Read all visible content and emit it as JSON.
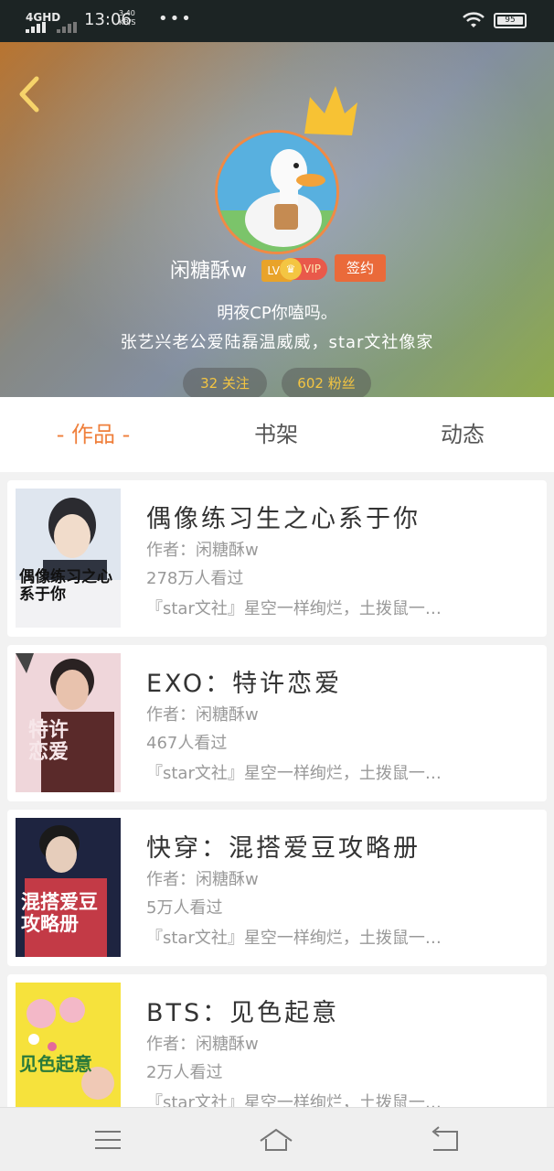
{
  "status_bar": {
    "network": "4GHD",
    "time": "13:06",
    "speed_value": "3.40",
    "speed_unit": "KB/S",
    "dots": "•••",
    "battery": "95"
  },
  "profile": {
    "level": "LV4",
    "username": "闲糖酥w",
    "vip_label": "VIP",
    "contract_label": "签约",
    "bio_line1": "明夜CP你嗑吗。",
    "bio_line2": "张艺兴老公爱陆磊温威威，star文社像家",
    "follow_label": "32 关注",
    "fans_label": "602 粉丝"
  },
  "tabs": [
    {
      "label": "- 作品 -",
      "active": true
    },
    {
      "label": "书架",
      "active": false
    },
    {
      "label": "动态",
      "active": false
    }
  ],
  "books": [
    {
      "title": "偶像练习生之心系于你",
      "author": "作者：闲糖酥w",
      "views": "278万人看过",
      "desc": "『star文社』星空一样绚烂，土拨鼠一…",
      "cover_text": "偶像练习之心系于你"
    },
    {
      "title": "EXO：特许恋爱",
      "author": "作者：闲糖酥w",
      "views": "467人看过",
      "desc": "『star文社』星空一样绚烂，土拨鼠一…",
      "cover_text": "特许恋爱"
    },
    {
      "title": "快穿：混搭爱豆攻略册",
      "author": "作者：闲糖酥w",
      "views": "5万人看过",
      "desc": "『star文社』星空一样绚烂，土拨鼠一…",
      "cover_text": "混搭爱豆攻略册"
    },
    {
      "title": "BTS：见色起意",
      "author": "作者：闲糖酥w",
      "views": "2万人看过",
      "desc": "『star文社』星空一样绚烂，土拨鼠一…",
      "cover_text": "见色起意"
    }
  ],
  "colors": {
    "accent": "#ef7f3b",
    "vip": "#e9594a",
    "level": "#e9a32a"
  },
  "icons": [
    "back-arrow-icon",
    "crown-icon",
    "menu-icon",
    "home-icon",
    "return-icon",
    "wifi-icon",
    "battery-icon"
  ]
}
